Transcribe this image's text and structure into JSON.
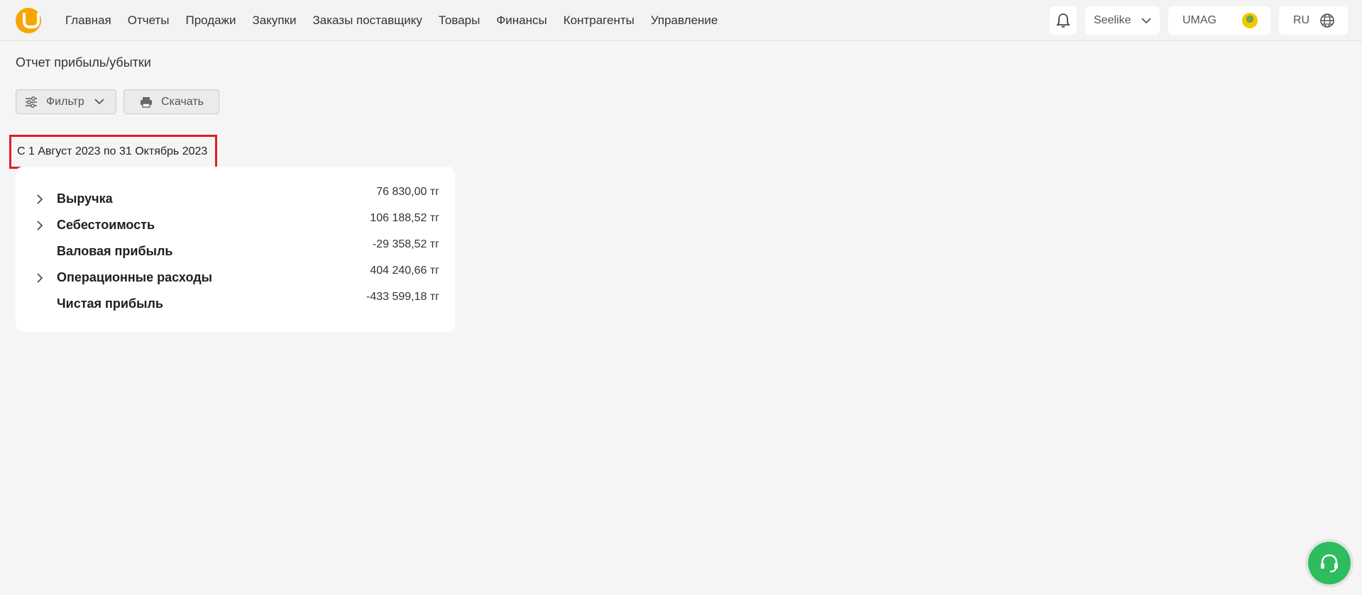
{
  "nav": {
    "items": [
      "Главная",
      "Отчеты",
      "Продажи",
      "Закупки",
      "Заказы поставщику",
      "Товары",
      "Финансы",
      "Контрагенты",
      "Управление"
    ]
  },
  "header": {
    "store_label": "Seelike",
    "account_label": "UMAG",
    "lang_label": "RU"
  },
  "page": {
    "title": "Отчет прибыль/убытки"
  },
  "toolbar": {
    "filter_label": "Фильтр",
    "download_label": "Скачать"
  },
  "report": {
    "date_range": "С 1 Август 2023 по 31 Октябрь 2023",
    "rows": [
      {
        "label": "Выручка",
        "value": "76 830,00 тг",
        "expandable": true
      },
      {
        "label": "Себестоимость",
        "value": "106 188,52 тг",
        "expandable": true
      },
      {
        "label": "Валовая прибыль",
        "value": "-29 358,52 тг",
        "expandable": false
      },
      {
        "label": "Операционные расходы",
        "value": "404 240,66 тг",
        "expandable": true
      },
      {
        "label": "Чистая прибыль",
        "value": "-433 599,18 тг",
        "expandable": false
      }
    ]
  },
  "colors": {
    "brand": "#f7a600",
    "highlight_border": "#e21b2c",
    "support_button": "#2dbd5e"
  },
  "icons": {
    "logo": "umag-logo-icon",
    "bell": "bell-icon",
    "chevron": "chevron-down-icon",
    "globe": "globe-icon",
    "filter": "sliders-icon",
    "print": "printer-icon",
    "row_expand": "chevron-right-icon",
    "support": "headset-icon"
  }
}
